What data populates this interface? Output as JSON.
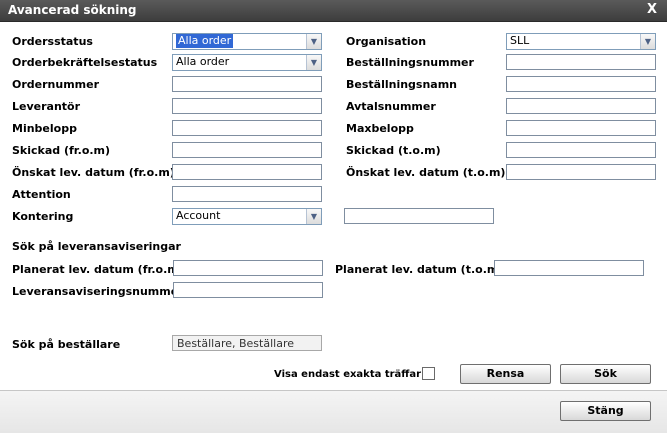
{
  "dialog": {
    "title": "Avancerad sökning",
    "close_label": "X"
  },
  "left": {
    "ordersstatus": {
      "label": "Ordersstatus",
      "value": "Alla order"
    },
    "orderbekraftelse": {
      "label": "Orderbekräftelsestatus",
      "value": "Alla order"
    },
    "ordernummer": {
      "label": "Ordernummer",
      "value": ""
    },
    "leverantor": {
      "label": "Leverantör",
      "value": ""
    },
    "minbelopp": {
      "label": "Minbelopp",
      "value": ""
    },
    "skickad_from": {
      "label": "Skickad (fr.o.m)",
      "value": ""
    },
    "onskat_from": {
      "label": "Önskat lev. datum (fr.o.m)",
      "value": ""
    },
    "attention": {
      "label": "Attention",
      "value": ""
    },
    "kontering": {
      "label": "Kontering",
      "value": "Account",
      "extra_value": ""
    }
  },
  "right": {
    "organisation": {
      "label": "Organisation",
      "value": "SLL"
    },
    "bestallningsnummer": {
      "label": "Beställningsnummer",
      "value": ""
    },
    "bestallningsnamn": {
      "label": "Beställningsnamn",
      "value": ""
    },
    "avtalsnummer": {
      "label": "Avtalsnummer",
      "value": ""
    },
    "maxbelopp": {
      "label": "Maxbelopp",
      "value": ""
    },
    "skickad_tom": {
      "label": "Skickad (t.o.m)",
      "value": ""
    },
    "onskat_tom": {
      "label": "Önskat lev. datum (t.o.m)",
      "value": ""
    }
  },
  "delivery": {
    "heading": "Sök på leveransaviseringar",
    "planerat_from": {
      "label": "Planerat lev. datum (fr.o.m)",
      "value": ""
    },
    "planerat_tom": {
      "label": "Planerat lev. datum (t.o.m)",
      "value": ""
    },
    "aviseringsnummer": {
      "label": "Leveransaviseringsnummer",
      "value": ""
    }
  },
  "orderer": {
    "label": "Sök på beställare",
    "value": "Beställare, Beställare"
  },
  "options": {
    "exact_label": "Visa endast exakta träffar",
    "exact_checked": false
  },
  "buttons": {
    "clear": "Rensa",
    "search": "Sök",
    "close": "Stäng"
  }
}
